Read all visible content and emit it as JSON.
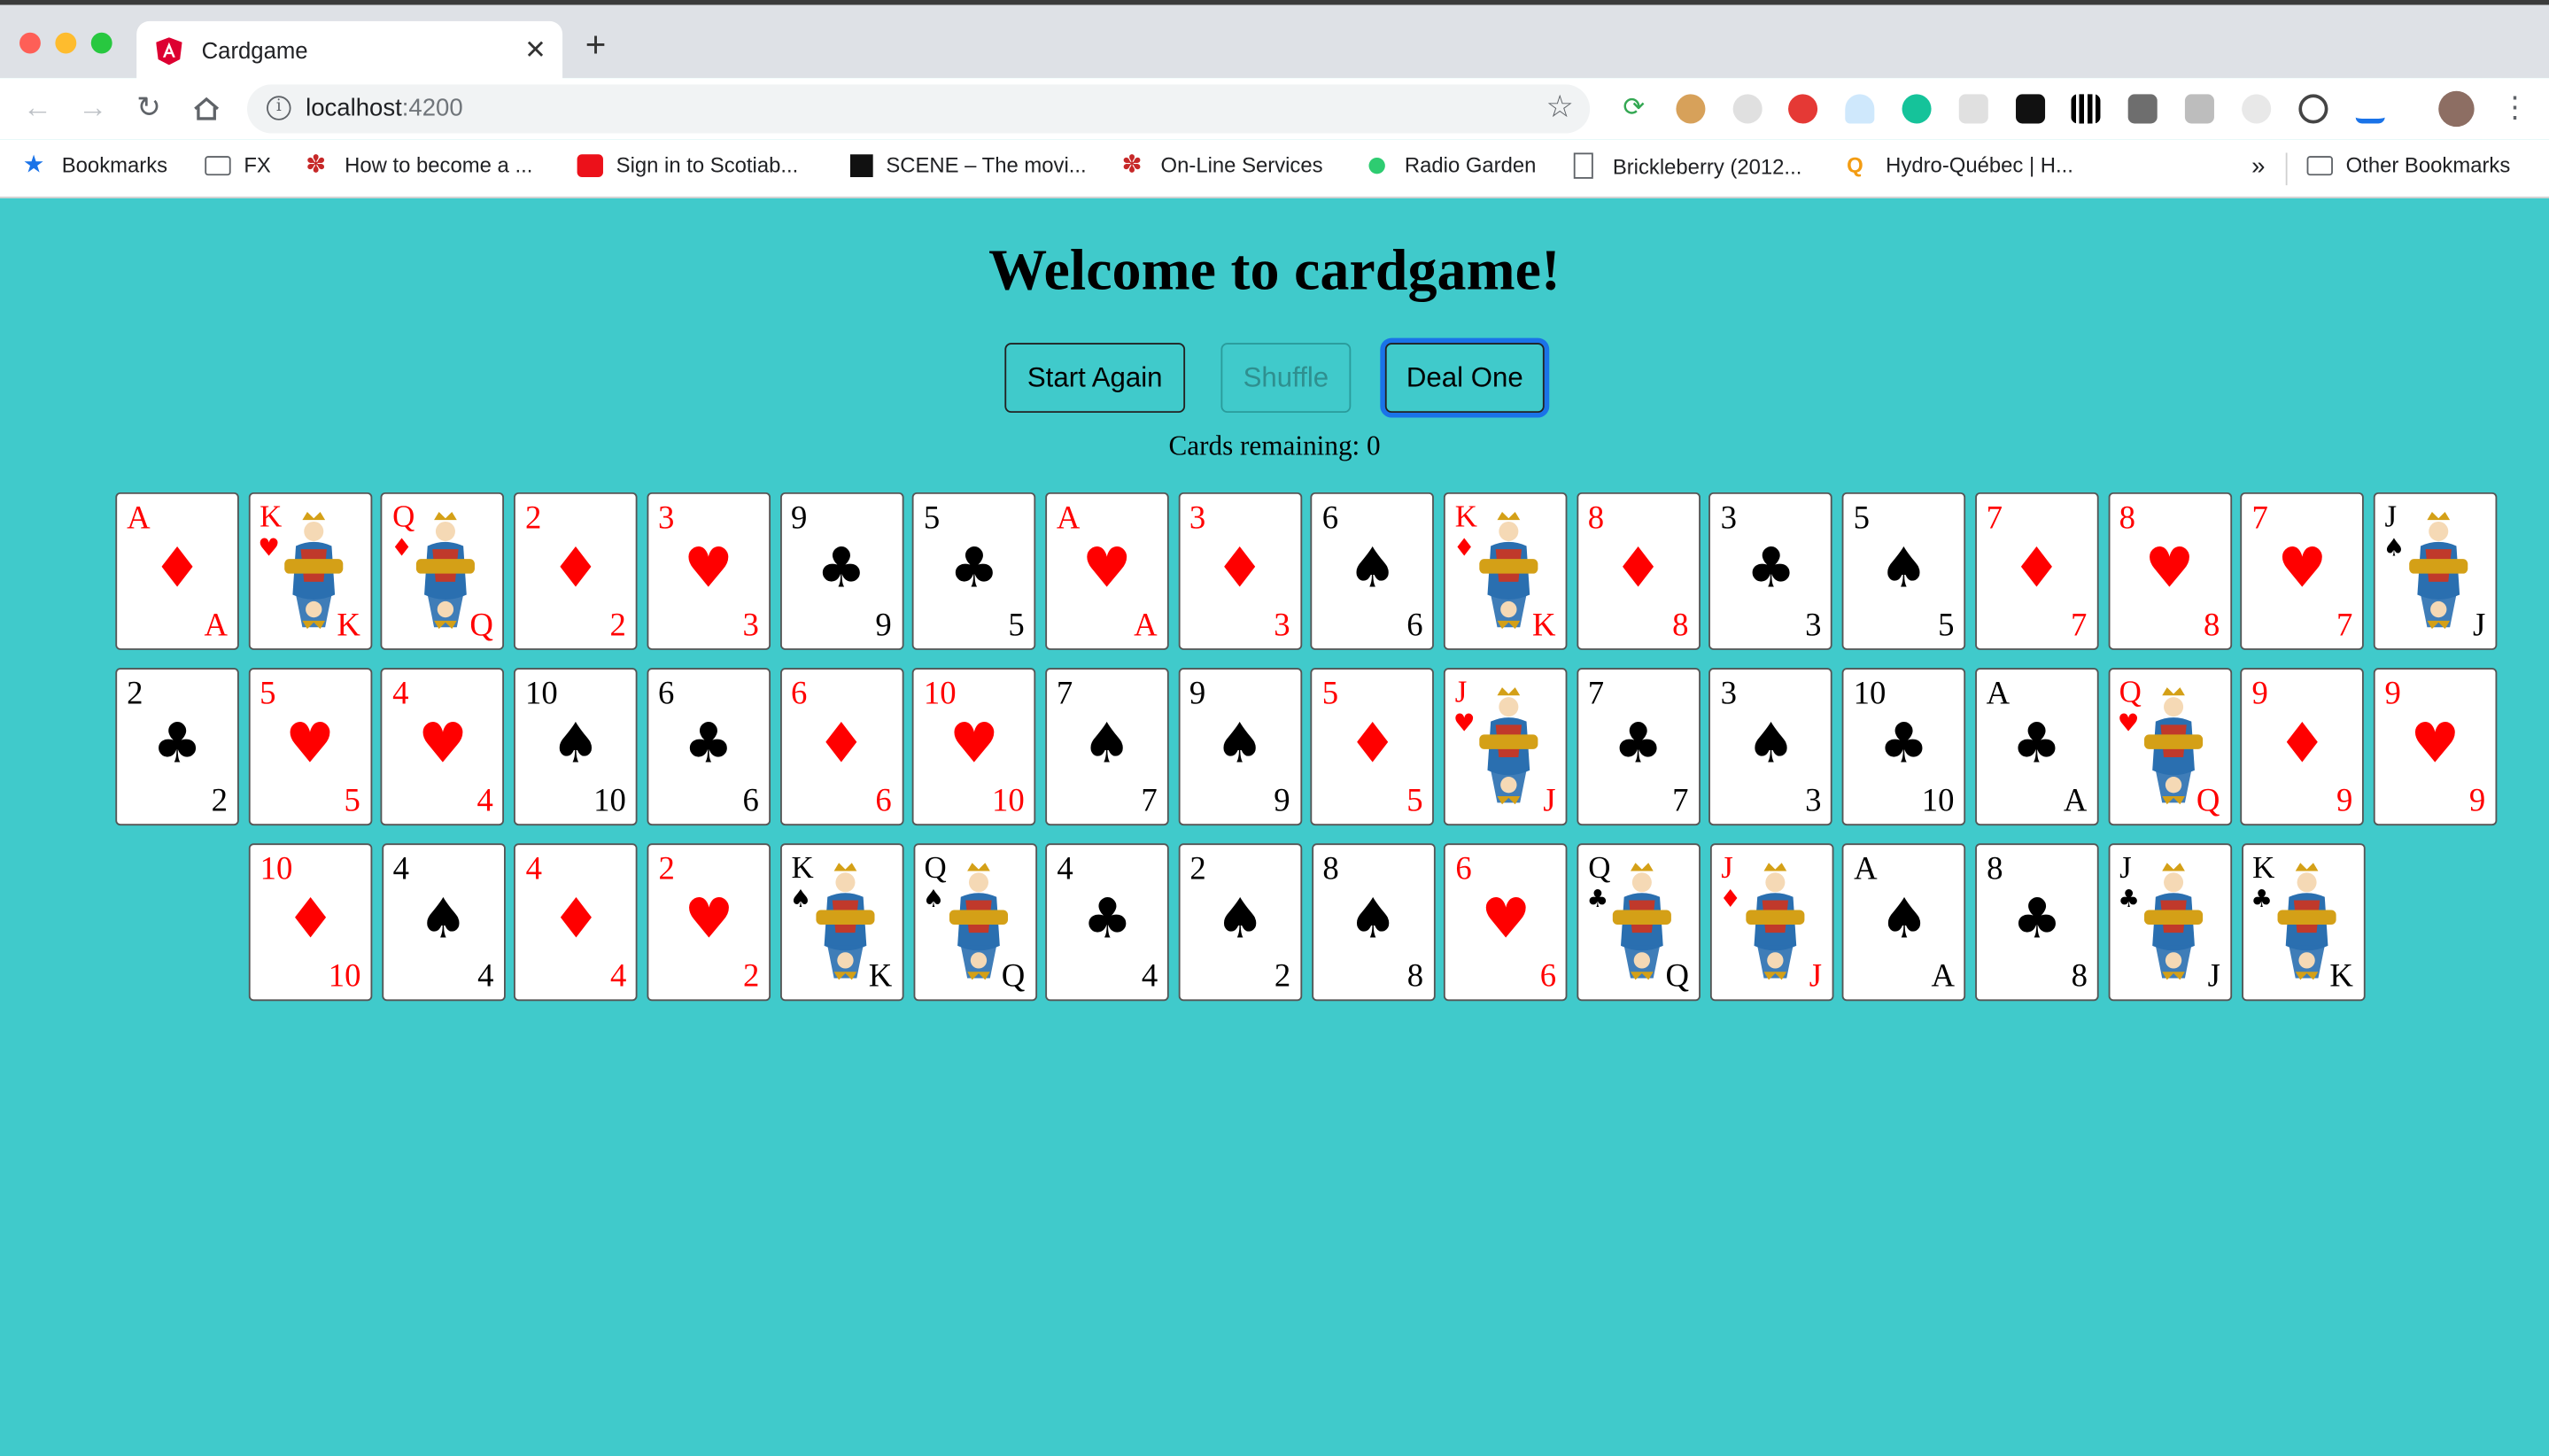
{
  "browser": {
    "tab_title": "Cardgame",
    "url_host": "localhost",
    "url_port": ":4200",
    "bookmarks": [
      {
        "label": "Bookmarks",
        "icon": "star-icon"
      },
      {
        "label": "FX",
        "icon": "folder-icon"
      },
      {
        "label": "How to become a ...",
        "icon": "maple-leaf-icon"
      },
      {
        "label": "Sign in to Scotiab...",
        "icon": "scotiabank-icon"
      },
      {
        "label": "SCENE – The movi...",
        "icon": "scene-icon"
      },
      {
        "label": "On-Line Services",
        "icon": "maple-leaf-icon"
      },
      {
        "label": "Radio Garden",
        "icon": "radio-garden-icon"
      },
      {
        "label": "Brickleberry (2012...",
        "icon": "page-icon"
      },
      {
        "label": "Hydro-Québec | H...",
        "icon": "hydro-quebec-icon"
      }
    ],
    "overflow_label": "»",
    "other_bookmarks": "Other Bookmarks"
  },
  "page": {
    "title": "Welcome to cardgame!",
    "buttons": {
      "start_again": "Start Again",
      "shuffle": "Shuffle",
      "deal_one": "Deal One"
    },
    "remaining_text": "Cards remaining: 0"
  },
  "colors": {
    "page_background": "#40cacb",
    "red_suit": "#ff0000",
    "black_suit": "#000000",
    "focus_ring": "#1a73e8"
  },
  "cards": [
    [
      {
        "rank": "A",
        "suit": "♦"
      },
      {
        "rank": "K",
        "suit": "♥"
      },
      {
        "rank": "Q",
        "suit": "♦"
      },
      {
        "rank": "2",
        "suit": "♦"
      },
      {
        "rank": "3",
        "suit": "♥"
      },
      {
        "rank": "9",
        "suit": "♣"
      },
      {
        "rank": "5",
        "suit": "♣"
      },
      {
        "rank": "A",
        "suit": "♥"
      },
      {
        "rank": "3",
        "suit": "♦"
      },
      {
        "rank": "6",
        "suit": "♠"
      },
      {
        "rank": "K",
        "suit": "♦"
      },
      {
        "rank": "8",
        "suit": "♦"
      },
      {
        "rank": "3",
        "suit": "♣"
      },
      {
        "rank": "5",
        "suit": "♠"
      },
      {
        "rank": "7",
        "suit": "♦"
      },
      {
        "rank": "8",
        "suit": "♥"
      },
      {
        "rank": "7",
        "suit": "♥"
      },
      {
        "rank": "J",
        "suit": "♠"
      }
    ],
    [
      {
        "rank": "2",
        "suit": "♣"
      },
      {
        "rank": "5",
        "suit": "♥"
      },
      {
        "rank": "4",
        "suit": "♥"
      },
      {
        "rank": "10",
        "suit": "♠"
      },
      {
        "rank": "6",
        "suit": "♣"
      },
      {
        "rank": "6",
        "suit": "♦"
      },
      {
        "rank": "10",
        "suit": "♥"
      },
      {
        "rank": "7",
        "suit": "♠"
      },
      {
        "rank": "9",
        "suit": "♠"
      },
      {
        "rank": "5",
        "suit": "♦"
      },
      {
        "rank": "J",
        "suit": "♥"
      },
      {
        "rank": "7",
        "suit": "♣"
      },
      {
        "rank": "3",
        "suit": "♠"
      },
      {
        "rank": "10",
        "suit": "♣"
      },
      {
        "rank": "A",
        "suit": "♣"
      },
      {
        "rank": "Q",
        "suit": "♥"
      },
      {
        "rank": "9",
        "suit": "♦"
      },
      {
        "rank": "9",
        "suit": "♥"
      }
    ],
    [
      {
        "rank": "10",
        "suit": "♦"
      },
      {
        "rank": "4",
        "suit": "♠"
      },
      {
        "rank": "4",
        "suit": "♦"
      },
      {
        "rank": "2",
        "suit": "♥"
      },
      {
        "rank": "K",
        "suit": "♠"
      },
      {
        "rank": "Q",
        "suit": "♠"
      },
      {
        "rank": "4",
        "suit": "♣"
      },
      {
        "rank": "2",
        "suit": "♠"
      },
      {
        "rank": "8",
        "suit": "♠"
      },
      {
        "rank": "6",
        "suit": "♥"
      },
      {
        "rank": "Q",
        "suit": "♣"
      },
      {
        "rank": "J",
        "suit": "♦"
      },
      {
        "rank": "A",
        "suit": "♠"
      },
      {
        "rank": "8",
        "suit": "♣"
      },
      {
        "rank": "J",
        "suit": "♣"
      },
      {
        "rank": "K",
        "suit": "♣"
      }
    ]
  ]
}
